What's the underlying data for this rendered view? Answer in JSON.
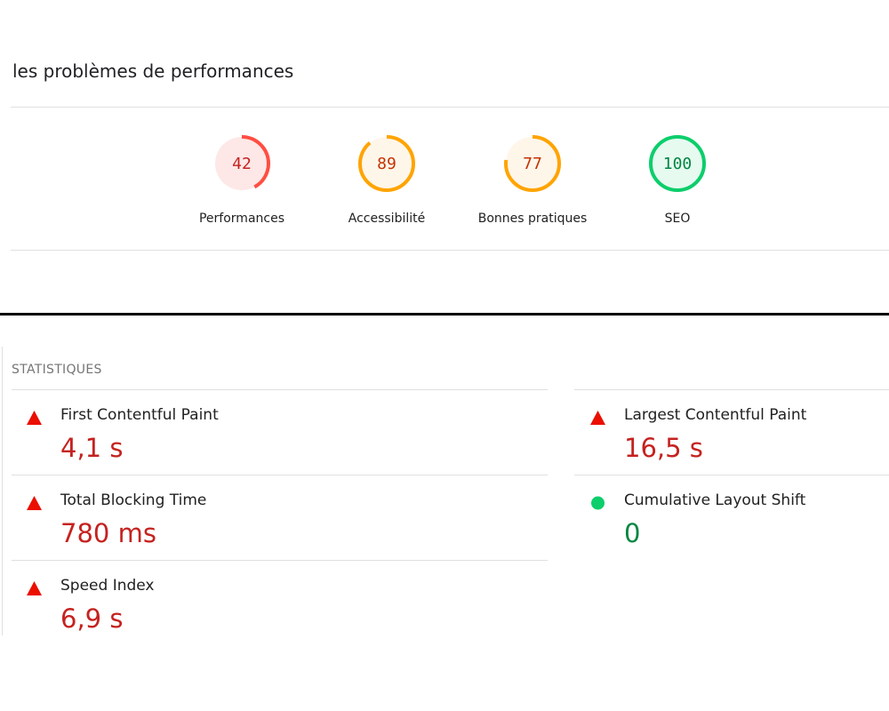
{
  "page": {
    "title": "les problèmes de performances"
  },
  "colors": {
    "fail": "#eb0f00",
    "fail_value": "#c5221f",
    "average": "#ffa400",
    "average_text": "#c33300",
    "pass": "#0cce6b",
    "pass_value": "#018642"
  },
  "gauges": [
    {
      "score": "42",
      "score_value": 42,
      "label": "Performances",
      "rating": "fail",
      "ring_color": "#ff4e42",
      "fill_color": "#fde8e7",
      "text_color": "#c5221f"
    },
    {
      "score": "89",
      "score_value": 89,
      "label": "Accessibilité",
      "rating": "average",
      "ring_color": "#ffa400",
      "fill_color": "#fff6ea",
      "text_color": "#c33300"
    },
    {
      "score": "77",
      "score_value": 77,
      "label": "Bonnes pratiques",
      "rating": "average",
      "ring_color": "#ffa400",
      "fill_color": "#fff6ea",
      "text_color": "#c33300"
    },
    {
      "score": "100",
      "score_value": 100,
      "label": "SEO",
      "rating": "pass",
      "ring_color": "#0cce6b",
      "fill_color": "#e6faf0",
      "text_color": "#018642"
    }
  ],
  "metrics": {
    "heading": "STATISTIQUES",
    "items": [
      {
        "label": "First Contentful Paint",
        "value": "4,1 s",
        "icon": "red-triangle-icon",
        "rating": "fail"
      },
      {
        "label": "Largest Contentful Paint",
        "value": "16,5 s",
        "icon": "red-triangle-icon",
        "rating": "fail"
      },
      {
        "label": "Total Blocking Time",
        "value": "780 ms",
        "icon": "red-triangle-icon",
        "rating": "fail"
      },
      {
        "label": "Cumulative Layout Shift",
        "value": "0",
        "icon": "green-circle-icon",
        "rating": "pass"
      },
      {
        "label": "Speed Index",
        "value": "6,9 s",
        "icon": "red-triangle-icon",
        "rating": "fail"
      }
    ]
  }
}
